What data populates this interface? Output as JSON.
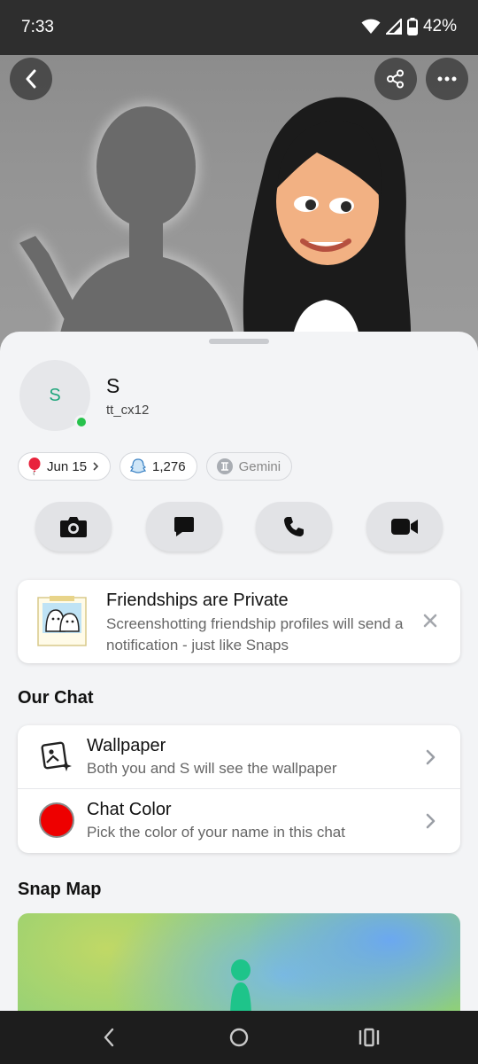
{
  "status_bar": {
    "time": "7:33",
    "battery": "42%"
  },
  "profile": {
    "avatar_initial": "S",
    "display_name": "S",
    "username": "tt_cx12"
  },
  "chips": [
    {
      "icon": "balloon-icon",
      "label": "Jun 15"
    },
    {
      "icon": "ghost-icon",
      "label": "1,276"
    },
    {
      "icon": "gemini-zodiac-icon",
      "label": "Gemini"
    }
  ],
  "actions": [
    "camera-icon",
    "chat-icon",
    "phone-icon",
    "video-icon"
  ],
  "notice": {
    "title": "Friendships are Private",
    "text": "Screenshotting friendship profiles will send a notification - just like Snaps"
  },
  "our_chat": {
    "title": "Our Chat",
    "items": [
      {
        "title": "Wallpaper",
        "subtitle": "Both you and S will see the wallpaper"
      },
      {
        "title": "Chat Color",
        "subtitle": "Pick the color of your name in this chat",
        "color": "#ee0000"
      }
    ]
  },
  "snap_map": {
    "title": "Snap Map"
  },
  "colors": {
    "online": "#27c24c",
    "avatar_initial": "#20a67c",
    "sheet_bg": "#f3f4f6"
  }
}
